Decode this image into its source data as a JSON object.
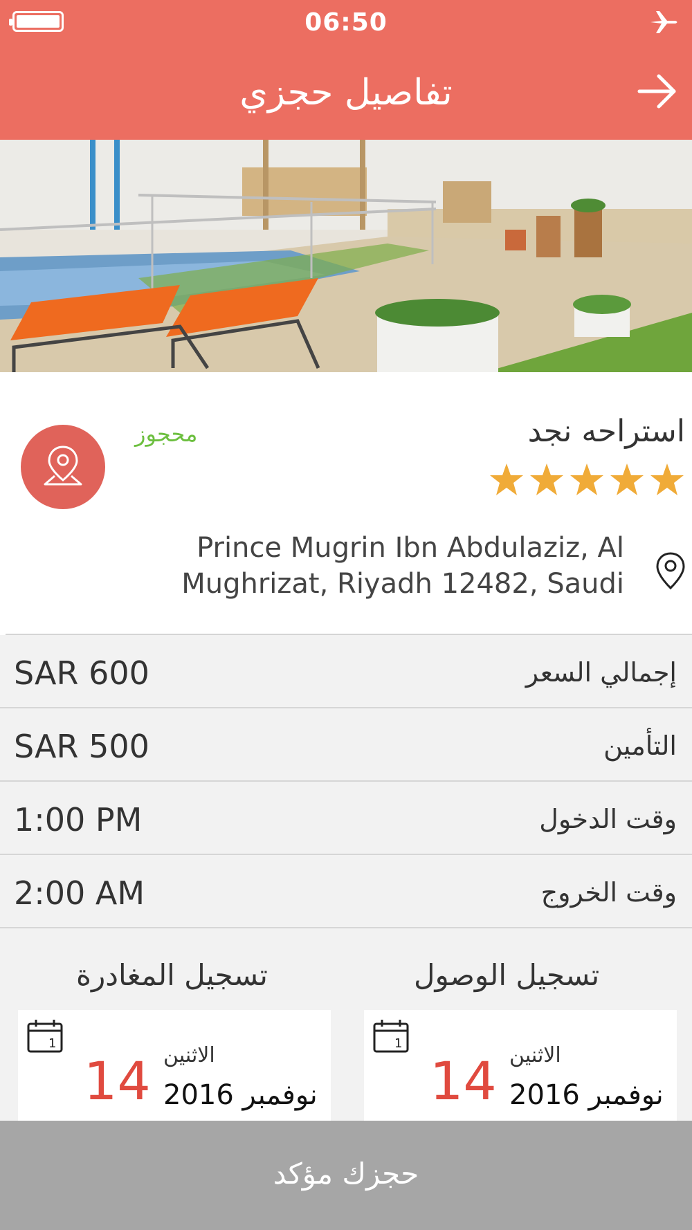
{
  "status_bar": {
    "time": "06:50"
  },
  "header": {
    "title": "تفاصيل حجزي"
  },
  "place": {
    "name": "استراحه نجد",
    "status": "محجوز",
    "rating": 5,
    "rating_max": 5,
    "address": "Prince Mugrin Ibn Abdulaziz, Al Mughrizat, Riyadh 12482, Saudi"
  },
  "details": [
    {
      "label": "إجمالي السعر",
      "value": "SAR 600"
    },
    {
      "label": "التأمين",
      "value": "SAR 500"
    },
    {
      "label": "وقت الدخول",
      "value": "1:00 PM"
    },
    {
      "label": "وقت الخروج",
      "value": "2:00 AM"
    }
  ],
  "checkin": {
    "title": "تسجيل الوصول",
    "weekday": "الاثنين",
    "day": "14",
    "month_year": "نوفمبر 2016",
    "calendar_icon_text": "1"
  },
  "checkout": {
    "title": "تسجيل المغادرة",
    "weekday": "الاثنين",
    "day": "14",
    "month_year": "نوفمبر 2016",
    "calendar_icon_text": "1"
  },
  "footer": {
    "confirm_label": "حجزك مؤكد"
  },
  "colors": {
    "brand": "#ec6e61",
    "star": "#f0ab38",
    "status": "#6cbf3f",
    "date_number": "#e04a3f",
    "confirm_bg": "#a6a6a6"
  }
}
